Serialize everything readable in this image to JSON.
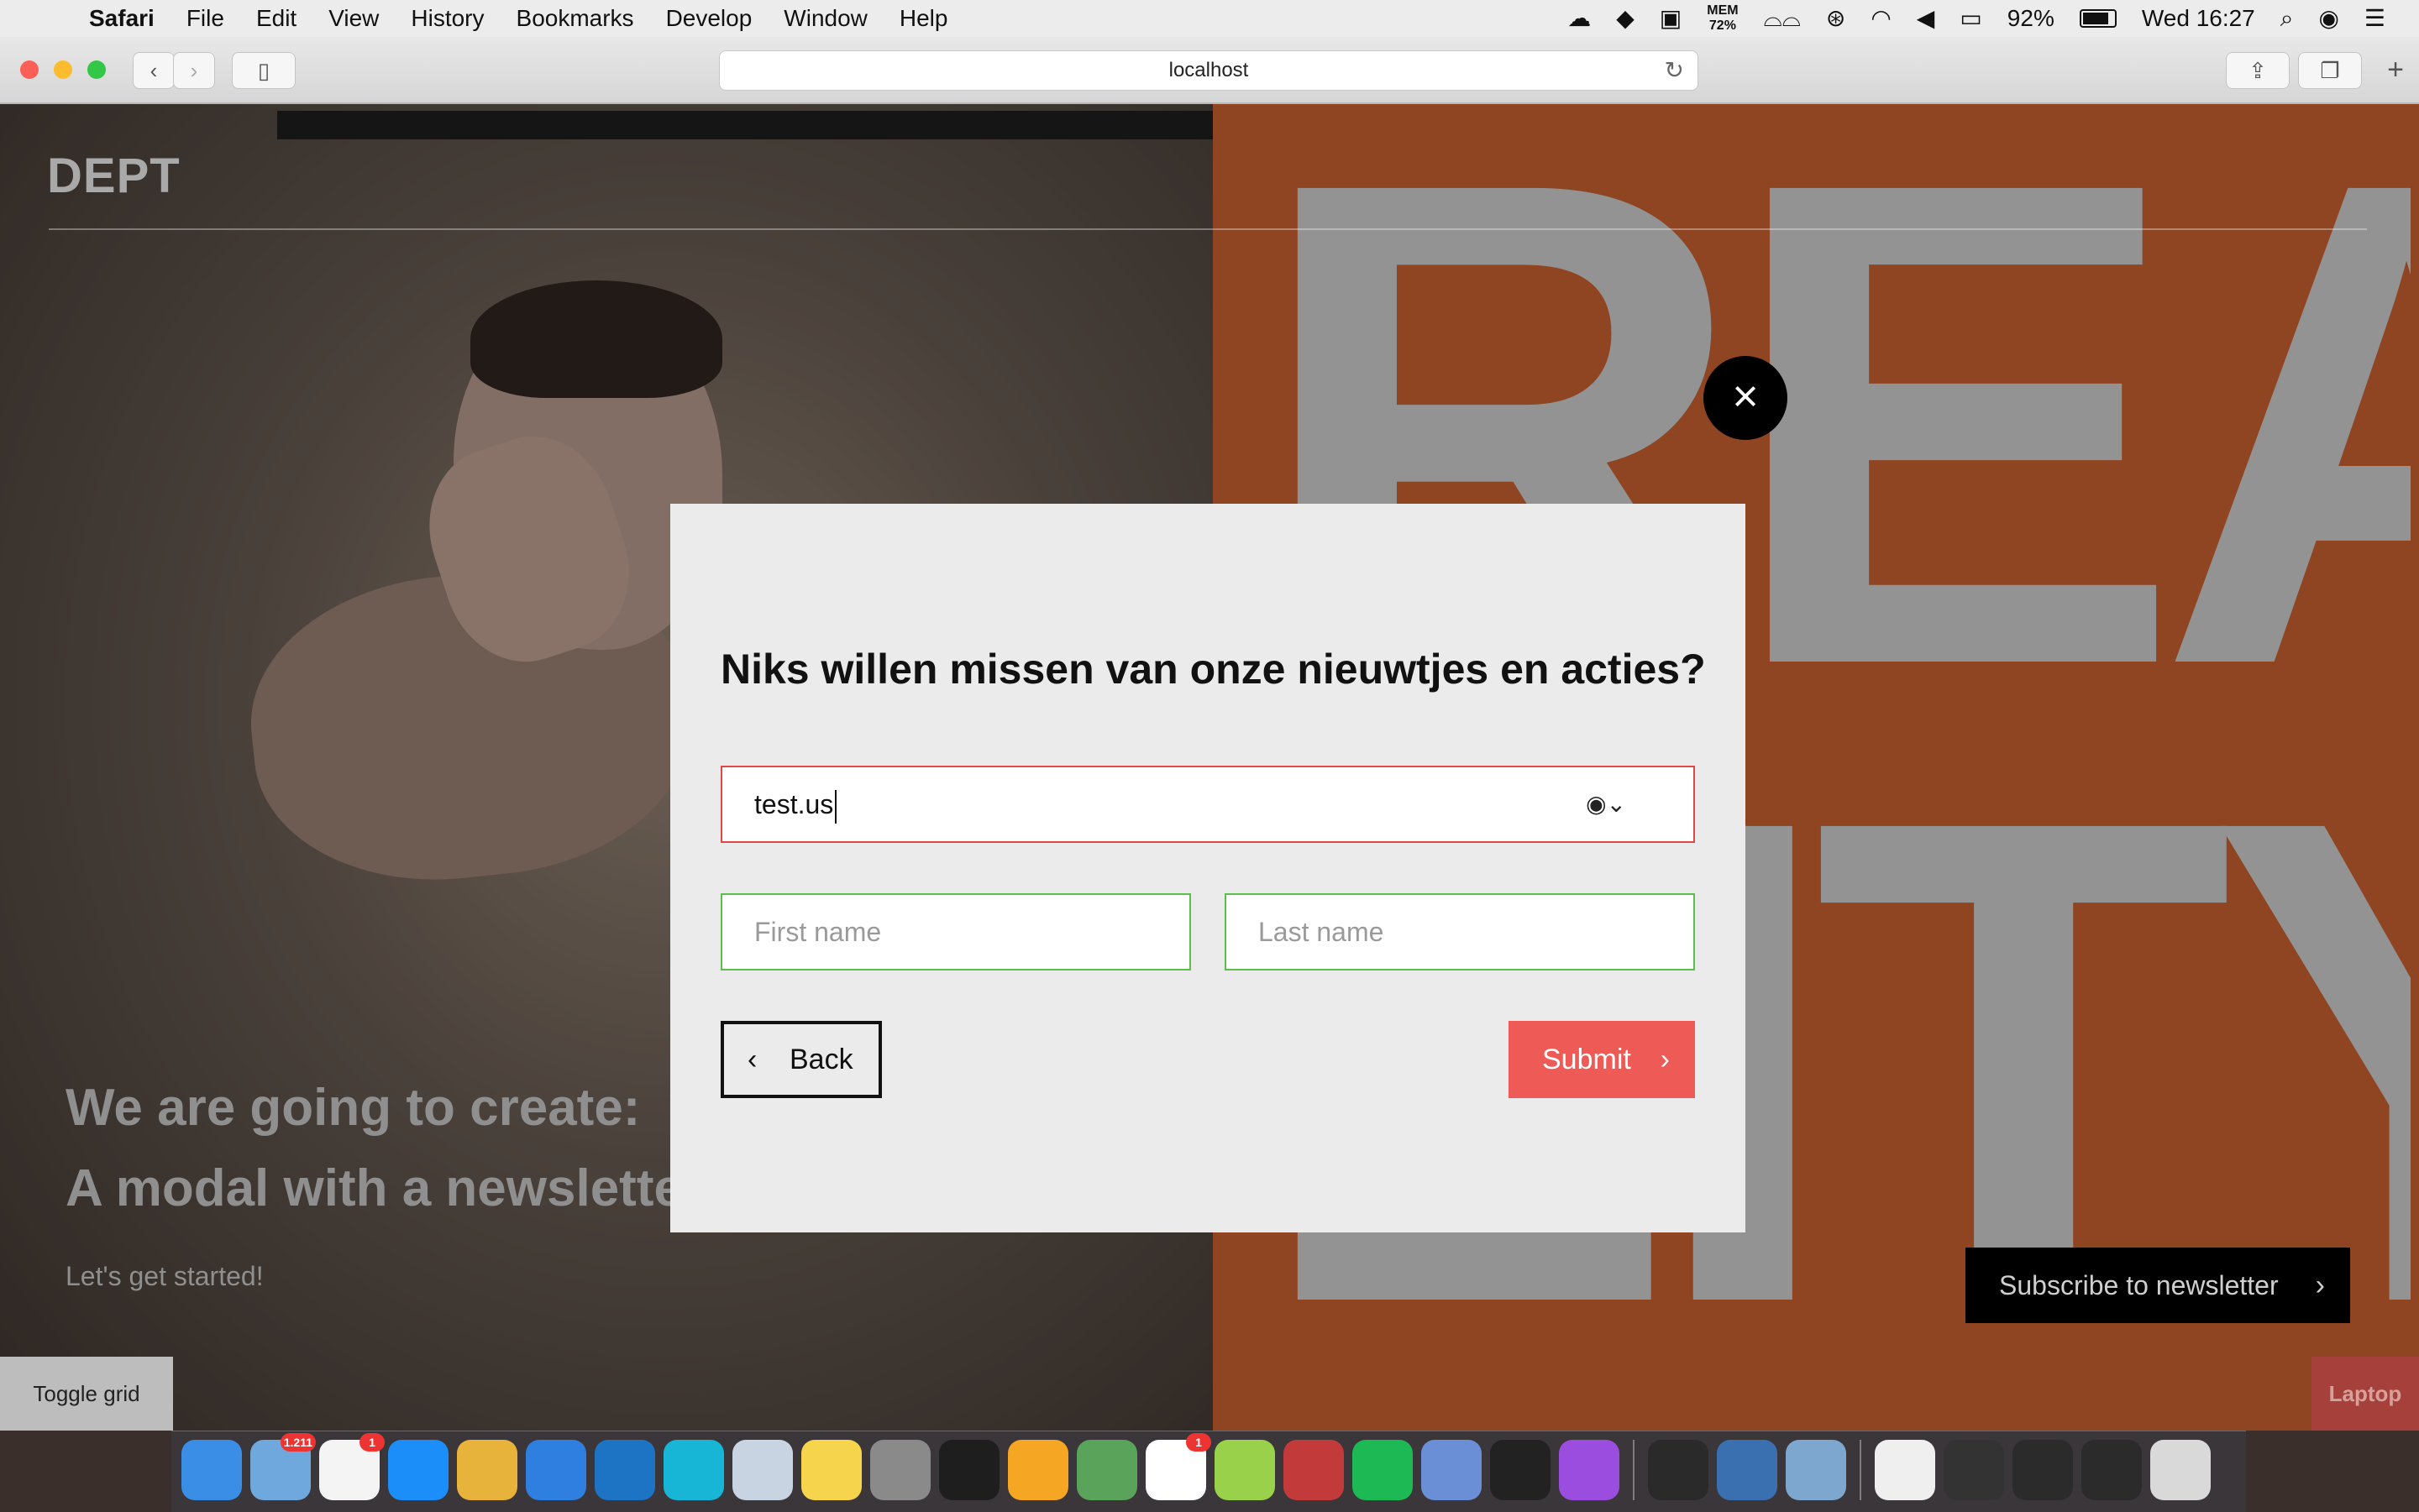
{
  "menubar": {
    "apple": "",
    "menus": [
      "Safari",
      "File",
      "Edit",
      "View",
      "History",
      "Bookmarks",
      "Develop",
      "Window",
      "Help"
    ],
    "mem_label": "MEM",
    "mem_value": "72%",
    "battery": "92%",
    "clock": "Wed 16:27"
  },
  "browser": {
    "url": "localhost",
    "back_glyph": "‹",
    "forward_glyph": "›"
  },
  "page": {
    "logo": "DEPT",
    "hero_line1": "We are going to create:",
    "hero_line2": "A modal with a newsletter form!!",
    "hero_sub": "Let's get started!",
    "subscribe_label": "Subscribe to newsletter",
    "toggle_grid_label": "Toggle grid",
    "breakpoint_label": "Laptop",
    "bg_letters_row1": "REA",
    "bg_letters_row2": "LITY"
  },
  "modal": {
    "close_glyph": "×",
    "title": "Niks willen missen van onze nieuwtjes en acties?",
    "email_value": "test.us",
    "first_name_placeholder": "First name",
    "last_name_placeholder": "Last name",
    "back_label": "Back",
    "submit_label": "Submit"
  },
  "dock": {
    "apps": [
      {
        "name": "finder",
        "color": "#3a8ee6",
        "badge": ""
      },
      {
        "name": "mail",
        "color": "#6fa8dc",
        "badge": "1.211"
      },
      {
        "name": "calendar",
        "color": "#f4f4f4",
        "badge": "1"
      },
      {
        "name": "app-store",
        "color": "#1c8ef9",
        "badge": ""
      },
      {
        "name": "chrome",
        "color": "#e8b33a",
        "badge": ""
      },
      {
        "name": "safari",
        "color": "#2f7fe0",
        "badge": ""
      },
      {
        "name": "vscode",
        "color": "#1d74c4",
        "badge": ""
      },
      {
        "name": "webstorm",
        "color": "#18b6d6",
        "badge": ""
      },
      {
        "name": "preview",
        "color": "#c9d4e2",
        "badge": ""
      },
      {
        "name": "notes",
        "color": "#f6d44c",
        "badge": ""
      },
      {
        "name": "system-preferences",
        "color": "#8a8a8a",
        "badge": ""
      },
      {
        "name": "terminal",
        "color": "#1e1e1e",
        "badge": ""
      },
      {
        "name": "sketch",
        "color": "#f5a623",
        "badge": ""
      },
      {
        "name": "git-client",
        "color": "#5aa35a",
        "badge": ""
      },
      {
        "name": "slack",
        "color": "#ffffff",
        "badge": "1"
      },
      {
        "name": "nvalt",
        "color": "#9ad14b",
        "badge": ""
      },
      {
        "name": "mail-pilot",
        "color": "#c23a3a",
        "badge": ""
      },
      {
        "name": "spotify",
        "color": "#1db954",
        "badge": ""
      },
      {
        "name": "network-utility",
        "color": "#6a8fd6",
        "badge": ""
      },
      {
        "name": "abstract",
        "color": "#222222",
        "badge": ""
      },
      {
        "name": "podcasts",
        "color": "#9b4de0",
        "badge": ""
      },
      {
        "name": "activity-monitor",
        "color": "#2a2a2a",
        "badge": ""
      },
      {
        "name": "quicktime",
        "color": "#3a6fb0",
        "badge": ""
      },
      {
        "name": "image-viewer",
        "color": "#7ea7d0",
        "badge": ""
      },
      {
        "name": "document",
        "color": "#efefef",
        "badge": ""
      },
      {
        "name": "abstract-folder",
        "color": "#333333",
        "badge": ""
      },
      {
        "name": "window-thumb-1",
        "color": "#2b2b2b",
        "badge": ""
      },
      {
        "name": "window-thumb-2",
        "color": "#2b2b2b",
        "badge": ""
      },
      {
        "name": "trash",
        "color": "#d9d9d9",
        "badge": ""
      }
    ]
  }
}
